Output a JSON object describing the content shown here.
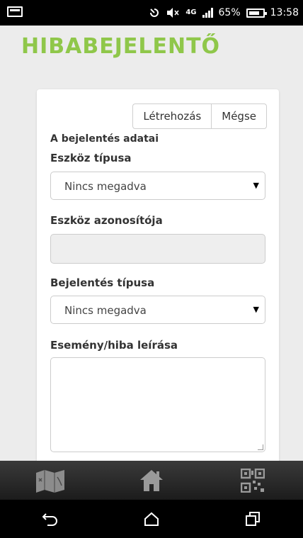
{
  "status_bar": {
    "battery_percent": "65%",
    "time": "13:58",
    "network": "4G"
  },
  "app": {
    "title": "HIBABEJELENTŐ",
    "accent_color": "#8fc74a"
  },
  "form": {
    "buttons": {
      "create_label": "Létrehozás",
      "cancel_label": "Mégse"
    },
    "section_title": "A bejelentés adatai",
    "device_type": {
      "label": "Eszköz típusa",
      "value": "Nincs megadva"
    },
    "device_id": {
      "label": "Eszköz azonosítója",
      "value": ""
    },
    "report_type": {
      "label": "Bejelentés típusa",
      "value": "Nincs megadva"
    },
    "description": {
      "label": "Esemény/hiba leírása",
      "value": ""
    }
  },
  "bottom_nav": {
    "items": [
      {
        "icon": "map-icon"
      },
      {
        "icon": "home-icon"
      },
      {
        "icon": "qr-code-icon"
      }
    ]
  },
  "system_nav": {
    "items": [
      {
        "icon": "back-icon"
      },
      {
        "icon": "home-outline-icon"
      },
      {
        "icon": "recent-apps-icon"
      }
    ]
  }
}
